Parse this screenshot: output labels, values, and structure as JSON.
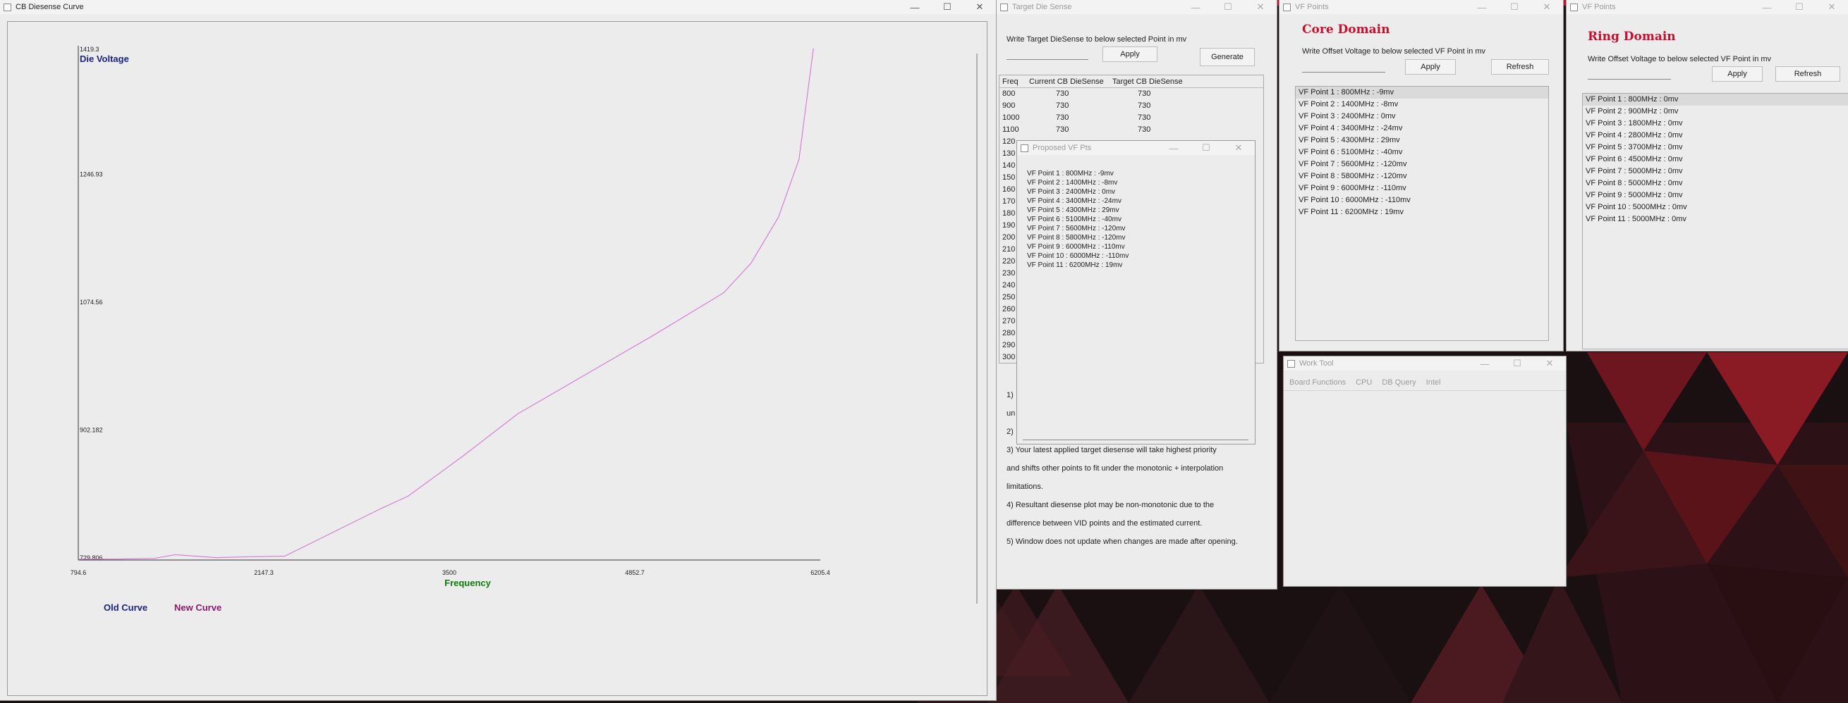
{
  "desktop": {
    "accent": "#c8102e"
  },
  "curve_window": {
    "title": "CB Diesense Curve",
    "controls": {
      "minimize": "—",
      "maximize": "☐",
      "close": "✕"
    },
    "ylabel": "Die Voltage",
    "xlabel": "Frequency",
    "legend_old": "Old Curve",
    "legend_new": "New Curve"
  },
  "chart_data": {
    "type": "line",
    "title": "",
    "xlabel": "Frequency",
    "ylabel": "Die Voltage",
    "xlim": [
      794.6,
      6205.4
    ],
    "ylim": [
      729.806,
      1419.3
    ],
    "x_ticks": [
      "794.6",
      "2147.3",
      "3500",
      "4852.7",
      "6205.4"
    ],
    "y_ticks": [
      "729.806",
      "902.182",
      "1074.56",
      "1246.93",
      "1419.3"
    ],
    "grid": false,
    "legend": "bottom-left",
    "series": [
      {
        "name": "New Curve",
        "color": "#d67fd6",
        "x": [
          794.6,
          1050,
          1350,
          1500,
          1800,
          2000,
          2300,
          3000,
          3200,
          3600,
          4000,
          5000,
          5500,
          5700,
          5900,
          6050,
          6155
        ],
        "y": [
          731,
          731,
          732,
          737,
          733,
          734,
          735,
          799,
          816,
          870,
          927,
          1034,
          1090,
          1130,
          1192,
          1270,
          1419.3
        ]
      }
    ]
  },
  "target_window": {
    "title": "Target Die Sense",
    "instruction": "Write Target DieSense to below selected Point in mv",
    "apply": "Apply",
    "generate": "Generate",
    "columns": [
      "Freq",
      "Current CB DieSense",
      "Target CB DieSense"
    ],
    "rows": [
      {
        "freq": "800",
        "current": "730",
        "target": "730"
      },
      {
        "freq": "900",
        "current": "730",
        "target": "730"
      },
      {
        "freq": "1000",
        "current": "730",
        "target": "730"
      },
      {
        "freq": "1100",
        "current": "730",
        "target": "730"
      },
      {
        "freq": "120",
        "current": "",
        "target": ""
      },
      {
        "freq": "130",
        "current": "",
        "target": ""
      },
      {
        "freq": "140",
        "current": "",
        "target": ""
      },
      {
        "freq": "150",
        "current": "",
        "target": ""
      },
      {
        "freq": "160",
        "current": "",
        "target": ""
      },
      {
        "freq": "170",
        "current": "",
        "target": ""
      },
      {
        "freq": "180",
        "current": "",
        "target": ""
      },
      {
        "freq": "190",
        "current": "",
        "target": ""
      },
      {
        "freq": "200",
        "current": "",
        "target": ""
      },
      {
        "freq": "210",
        "current": "",
        "target": ""
      },
      {
        "freq": "220",
        "current": "",
        "target": ""
      },
      {
        "freq": "230",
        "current": "",
        "target": ""
      },
      {
        "freq": "240",
        "current": "",
        "target": ""
      },
      {
        "freq": "250",
        "current": "",
        "target": ""
      },
      {
        "freq": "260",
        "current": "",
        "target": ""
      },
      {
        "freq": "270",
        "current": "",
        "target": ""
      },
      {
        "freq": "280",
        "current": "",
        "target": ""
      },
      {
        "freq": "290",
        "current": "",
        "target": ""
      },
      {
        "freq": "300",
        "current": "",
        "target": ""
      }
    ],
    "notes": [
      "1)",
      "un",
      "2)",
      "3) Your latest applied target diesense will take highest priority",
      "and shifts other points to fit under the monotonic + interpolation",
      "limitations.",
      "4) Resultant diesense plot may be non-monotonic due to the",
      "difference between VID points and the estimated current.",
      "5) Window does not update when changes are made after opening."
    ]
  },
  "proposed_window": {
    "title": "Proposed VF Pts",
    "items": [
      "VF Point 1 : 800MHz : -9mv",
      "VF Point 2 : 1400MHz : -8mv",
      "VF Point 3 : 2400MHz : 0mv",
      "VF Point 4 : 3400MHz : -24mv",
      "VF Point 5 : 4300MHz : 29mv",
      "VF Point 6 : 5100MHz : -40mv",
      "VF Point 7 : 5600MHz : -120mv",
      "VF Point 8 : 5800MHz : -120mv",
      "VF Point 9 : 6000MHz : -110mv",
      "VF Point 10 : 6000MHz : -110mv",
      "VF Point 11 : 6200MHz : 19mv"
    ]
  },
  "core_window": {
    "title": "VF Points",
    "heading": "Core Domain",
    "instruction": "Write Offset Voltage to below selected VF Point in mv",
    "apply": "Apply",
    "refresh": "Refresh",
    "items": [
      "VF Point 1 : 800MHz : -9mv",
      "VF Point 2 : 1400MHz : -8mv",
      "VF Point 3 : 2400MHz : 0mv",
      "VF Point 4 : 3400MHz : -24mv",
      "VF Point 5 : 4300MHz : 29mv",
      "VF Point 6 : 5100MHz : -40mv",
      "VF Point 7 : 5600MHz : -120mv",
      "VF Point 8 : 5800MHz : -120mv",
      "VF Point 9 : 6000MHz : -110mv",
      "VF Point 10 : 6000MHz : -110mv",
      "VF Point 11 : 6200MHz : 19mv"
    ]
  },
  "ring_window": {
    "title": "VF Points",
    "heading": "Ring Domain",
    "instruction": "Write Offset Voltage to below selected VF Point in mv",
    "apply": "Apply",
    "refresh": "Refresh",
    "items": [
      "VF Point 1 : 800MHz : 0mv",
      "VF Point 2 : 900MHz : 0mv",
      "VF Point 3 : 1800MHz : 0mv",
      "VF Point 4 : 2800MHz : 0mv",
      "VF Point 5 : 3700MHz : 0mv",
      "VF Point 6 : 4500MHz : 0mv",
      "VF Point 7 : 5000MHz : 0mv",
      "VF Point 8 : 5000MHz : 0mv",
      "VF Point 9 : 5000MHz : 0mv",
      "VF Point 10 : 5000MHz : 0mv",
      "VF Point 11 : 5000MHz : 0mv"
    ]
  },
  "work_window": {
    "title": "Work Tool",
    "menu": [
      "Board Functions",
      "CPU",
      "DB Query",
      "Intel"
    ]
  }
}
